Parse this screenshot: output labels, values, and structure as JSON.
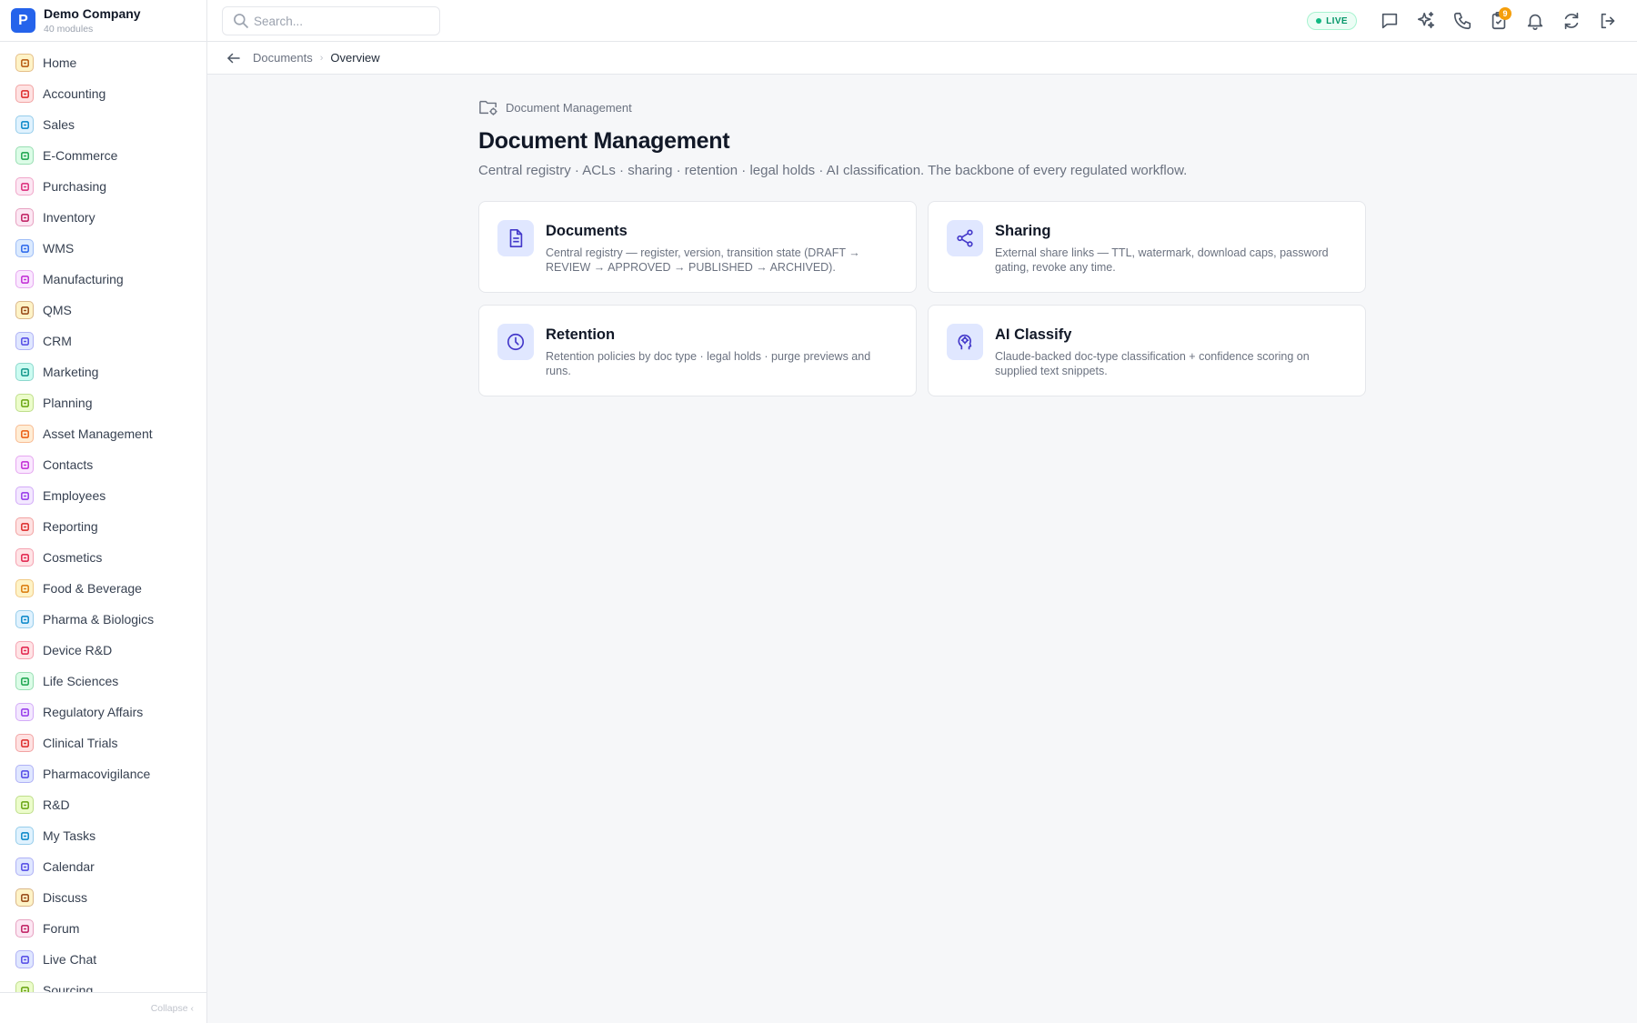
{
  "brand": {
    "logo_letter": "P",
    "name": "Demo Company",
    "subtitle": "40 modules"
  },
  "sidebar": {
    "items": [
      {
        "label": "Home",
        "icon": "home-grid-icon",
        "color": "#b45309",
        "bg": "#fef3c7"
      },
      {
        "label": "Accounting",
        "icon": "bank-icon",
        "color": "#dc2626",
        "bg": "#fee2e2"
      },
      {
        "label": "Sales",
        "icon": "user-icon",
        "color": "#0284c7",
        "bg": "#e0f2fe"
      },
      {
        "label": "E-Commerce",
        "icon": "store-icon",
        "color": "#16a34a",
        "bg": "#dcfce7"
      },
      {
        "label": "Purchasing",
        "icon": "cart-icon",
        "color": "#db2777",
        "bg": "#fce7f3"
      },
      {
        "label": "Inventory",
        "icon": "archive-icon",
        "color": "#be185d",
        "bg": "#fce7f3"
      },
      {
        "label": "WMS",
        "icon": "warehouse-icon",
        "color": "#2563eb",
        "bg": "#dbeafe"
      },
      {
        "label": "Manufacturing",
        "icon": "factory-icon",
        "color": "#c026d3",
        "bg": "#fae8ff"
      },
      {
        "label": "QMS",
        "icon": "check-badge-icon",
        "color": "#92400e",
        "bg": "#fef3c7"
      },
      {
        "label": "CRM",
        "icon": "users-icon",
        "color": "#4f46e5",
        "bg": "#e0e7ff"
      },
      {
        "label": "Marketing",
        "icon": "megaphone-icon",
        "color": "#0d9488",
        "bg": "#ccfbf1"
      },
      {
        "label": "Planning",
        "icon": "calendar-check-icon",
        "color": "#65a30d",
        "bg": "#ecfccb"
      },
      {
        "label": "Asset Management",
        "icon": "tools-icon",
        "color": "#ea580c",
        "bg": "#ffedd5"
      },
      {
        "label": "Contacts",
        "icon": "contact-card-icon",
        "color": "#c026d3",
        "bg": "#fae8ff"
      },
      {
        "label": "Employees",
        "icon": "badge-icon",
        "color": "#9333ea",
        "bg": "#f3e8ff"
      },
      {
        "label": "Reporting",
        "icon": "bar-chart-icon",
        "color": "#dc2626",
        "bg": "#fee2e2"
      },
      {
        "label": "Cosmetics",
        "icon": "flower-icon",
        "color": "#e11d48",
        "bg": "#ffe4e6"
      },
      {
        "label": "Food & Beverage",
        "icon": "utensils-icon",
        "color": "#d97706",
        "bg": "#fef3c7"
      },
      {
        "label": "Pharma & Biologics",
        "icon": "pill-bottle-icon",
        "color": "#0284c7",
        "bg": "#e0f2fe"
      },
      {
        "label": "Device R&D",
        "icon": "cog-icon",
        "color": "#e11d48",
        "bg": "#ffe4e6"
      },
      {
        "label": "Life Sciences",
        "icon": "microscope-icon",
        "color": "#16a34a",
        "bg": "#dcfce7"
      },
      {
        "label": "Regulatory Affairs",
        "icon": "gavel-icon",
        "color": "#9333ea",
        "bg": "#f3e8ff"
      },
      {
        "label": "Clinical Trials",
        "icon": "clipboard-icon",
        "color": "#dc2626",
        "bg": "#fee2e2"
      },
      {
        "label": "Pharmacovigilance",
        "icon": "shield-icon",
        "color": "#4f46e5",
        "bg": "#e0e7ff"
      },
      {
        "label": "R&D",
        "icon": "flask-icon",
        "color": "#65a30d",
        "bg": "#ecfccb"
      },
      {
        "label": "My Tasks",
        "icon": "checklist-icon",
        "color": "#0284c7",
        "bg": "#e0f2fe"
      },
      {
        "label": "Calendar",
        "icon": "calendar-icon",
        "color": "#4f46e5",
        "bg": "#e0e7ff"
      },
      {
        "label": "Discuss",
        "icon": "chat-icon",
        "color": "#92400e",
        "bg": "#fef3c7"
      },
      {
        "label": "Forum",
        "icon": "forum-icon",
        "color": "#be185d",
        "bg": "#fce7f3"
      },
      {
        "label": "Live Chat",
        "icon": "headset-icon",
        "color": "#4f46e5",
        "bg": "#e0e7ff"
      },
      {
        "label": "Sourcing",
        "icon": "target-icon",
        "color": "#65a30d",
        "bg": "#ecfccb"
      }
    ],
    "collapse_label": "Collapse ‹"
  },
  "topbar": {
    "search_placeholder": "Search...",
    "live_label": "LIVE",
    "notification_count": "9"
  },
  "breadcrumb": {
    "parent": "Documents",
    "current": "Overview"
  },
  "page": {
    "eyebrow": "Document Management",
    "title": "Document Management",
    "subtitle": "Central registry · ACLs · sharing · retention · legal holds · AI classification. The backbone of every regulated workflow.",
    "cards": [
      {
        "title": "Documents",
        "desc": "Central registry — register, version, transition state (DRAFT → REVIEW → APPROVED → PUBLISHED → ARCHIVED).",
        "icon": "document-icon"
      },
      {
        "title": "Sharing",
        "desc": "External share links — TTL, watermark, download caps, password gating, revoke any time.",
        "icon": "share-icon"
      },
      {
        "title": "Retention",
        "desc": "Retention policies by doc type · legal holds · purge previews and runs.",
        "icon": "clock-icon"
      },
      {
        "title": "AI Classify",
        "desc": "Claude-backed doc-type classification + confidence scoring on supplied text snippets.",
        "icon": "brain-icon"
      }
    ]
  },
  "colors": {
    "accent": "#2563eb",
    "card_icon": "#4338ca",
    "card_icon_bg": "#e0e7ff",
    "live": "#059669",
    "badge": "#f59e0b"
  }
}
